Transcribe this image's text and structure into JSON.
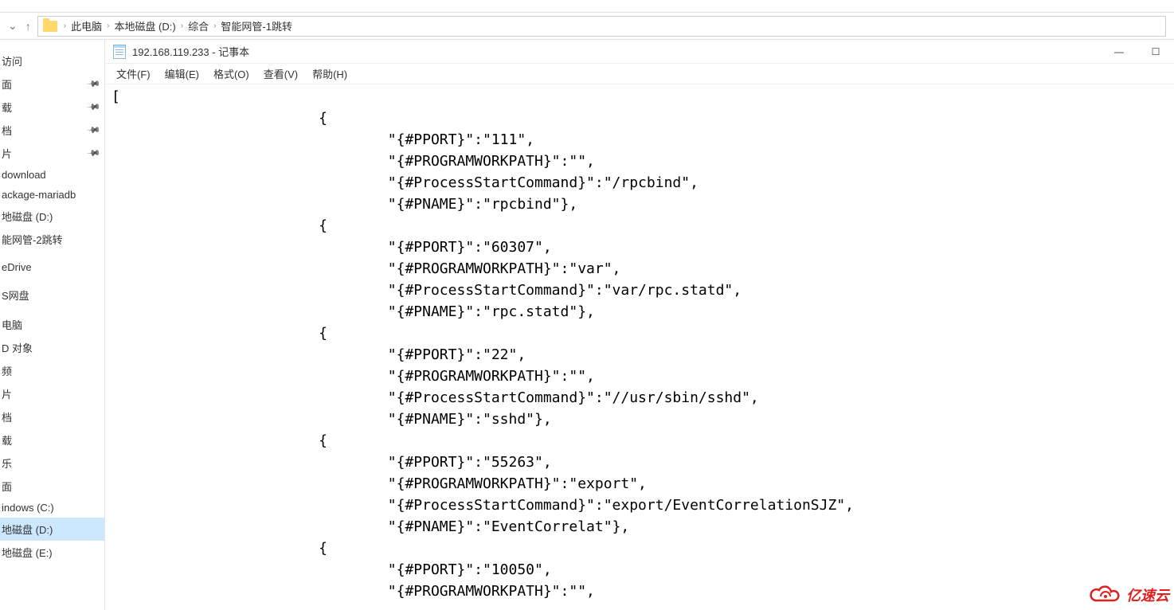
{
  "breadcrumb": {
    "items": [
      "此电脑",
      "本地磁盘 (D:)",
      "综合",
      "智能网管-1跳转"
    ]
  },
  "sidebar": {
    "items": [
      {
        "label": "访问",
        "pinned": false
      },
      {
        "label": "面",
        "pinned": true
      },
      {
        "label": "载",
        "pinned": true
      },
      {
        "label": "档",
        "pinned": true
      },
      {
        "label": "片",
        "pinned": true
      },
      {
        "label": "download",
        "pinned": false
      },
      {
        "label": "ackage-mariadb",
        "pinned": false
      },
      {
        "label": "地磁盘 (D:)",
        "pinned": false
      },
      {
        "label": "能网管-2跳转",
        "pinned": false
      },
      {
        "label": "eDrive",
        "pinned": false
      },
      {
        "label": "S网盘",
        "pinned": false
      },
      {
        "label": "电脑",
        "pinned": false
      },
      {
        "label": "D 对象",
        "pinned": false
      },
      {
        "label": "频",
        "pinned": false
      },
      {
        "label": "片",
        "pinned": false
      },
      {
        "label": "档",
        "pinned": false
      },
      {
        "label": "载",
        "pinned": false
      },
      {
        "label": "乐",
        "pinned": false
      },
      {
        "label": "面",
        "pinned": false
      },
      {
        "label": "indows (C:)",
        "pinned": false
      },
      {
        "label": "地磁盘 (D:)",
        "pinned": false,
        "selected": true
      },
      {
        "label": "地磁盘 (E:)",
        "pinned": false
      }
    ]
  },
  "notepad": {
    "title": "192.168.119.233 - 记事本",
    "menu": {
      "file": "文件(F)",
      "edit": "编辑(E)",
      "format": "格式(O)",
      "view": "查看(V)",
      "help": "帮助(H)"
    },
    "content": "[\n                        {\n                                \"{#PPORT}\":\"111\",\n                                \"{#PROGRAMWORKPATH}\":\"\",\n                                \"{#ProcessStartCommand}\":\"/rpcbind\",\n                                \"{#PNAME}\":\"rpcbind\"},\n                        {\n                                \"{#PPORT}\":\"60307\",\n                                \"{#PROGRAMWORKPATH}\":\"var\",\n                                \"{#ProcessStartCommand}\":\"var/rpc.statd\",\n                                \"{#PNAME}\":\"rpc.statd\"},\n                        {\n                                \"{#PPORT}\":\"22\",\n                                \"{#PROGRAMWORKPATH}\":\"\",\n                                \"{#ProcessStartCommand}\":\"//usr/sbin/sshd\",\n                                \"{#PNAME}\":\"sshd\"},\n                        {\n                                \"{#PPORT}\":\"55263\",\n                                \"{#PROGRAMWORKPATH}\":\"export\",\n                                \"{#ProcessStartCommand}\":\"export/EventCorrelationSJZ\",\n                                \"{#PNAME}\":\"EventCorrelat\"},\n                        {\n                                \"{#PPORT}\":\"10050\",\n                                \"{#PROGRAMWORKPATH}\":\"\","
  },
  "watermark": {
    "text": "亿速云"
  }
}
